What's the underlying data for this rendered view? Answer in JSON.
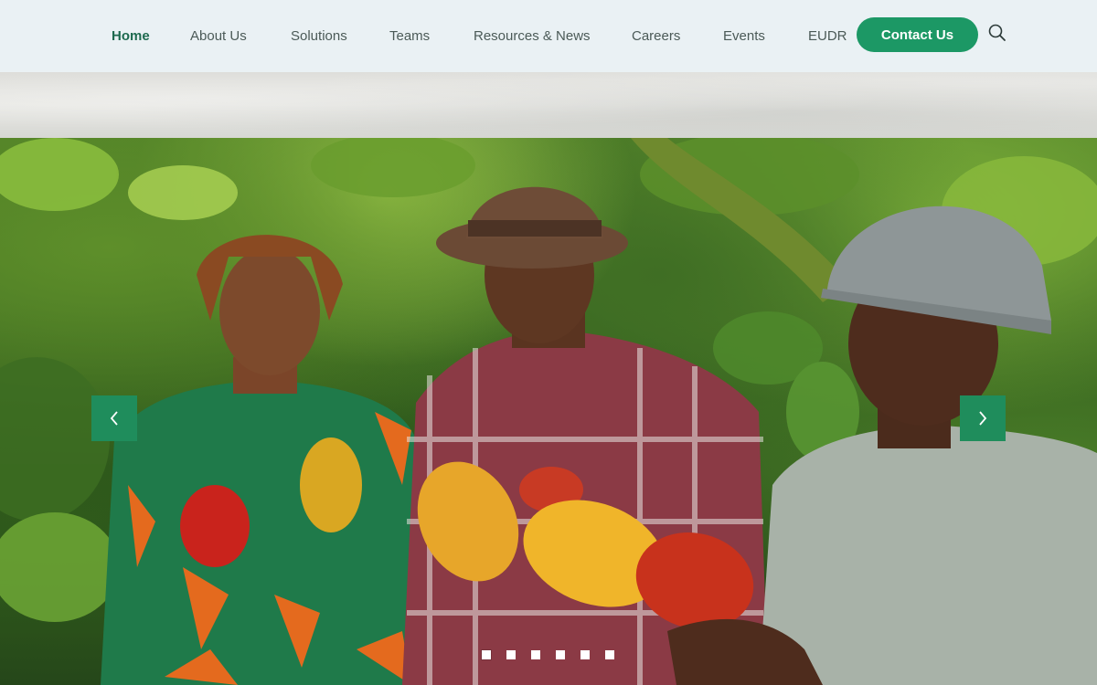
{
  "nav": {
    "items": [
      {
        "label": "Home",
        "active": true
      },
      {
        "label": "About Us",
        "active": false
      },
      {
        "label": "Solutions",
        "active": false
      },
      {
        "label": "Teams",
        "active": false
      },
      {
        "label": "Resources & News",
        "active": false
      },
      {
        "label": "Careers",
        "active": false
      },
      {
        "label": "Events",
        "active": false
      },
      {
        "label": "EUDR",
        "active": false
      }
    ],
    "contact_label": "Contact Us",
    "search_icon": "search-icon"
  },
  "hero": {
    "slide_count": 6,
    "active_slide": 1,
    "prev_icon": "chevron-left-icon",
    "next_icon": "chevron-right-icon"
  },
  "colors": {
    "brand_green": "#1c9865",
    "nav_bg": "#eaf1f4",
    "nav_text": "#4b5a57",
    "nav_active": "#1e6a4f",
    "arrow_bg": "#1f8d5c"
  }
}
